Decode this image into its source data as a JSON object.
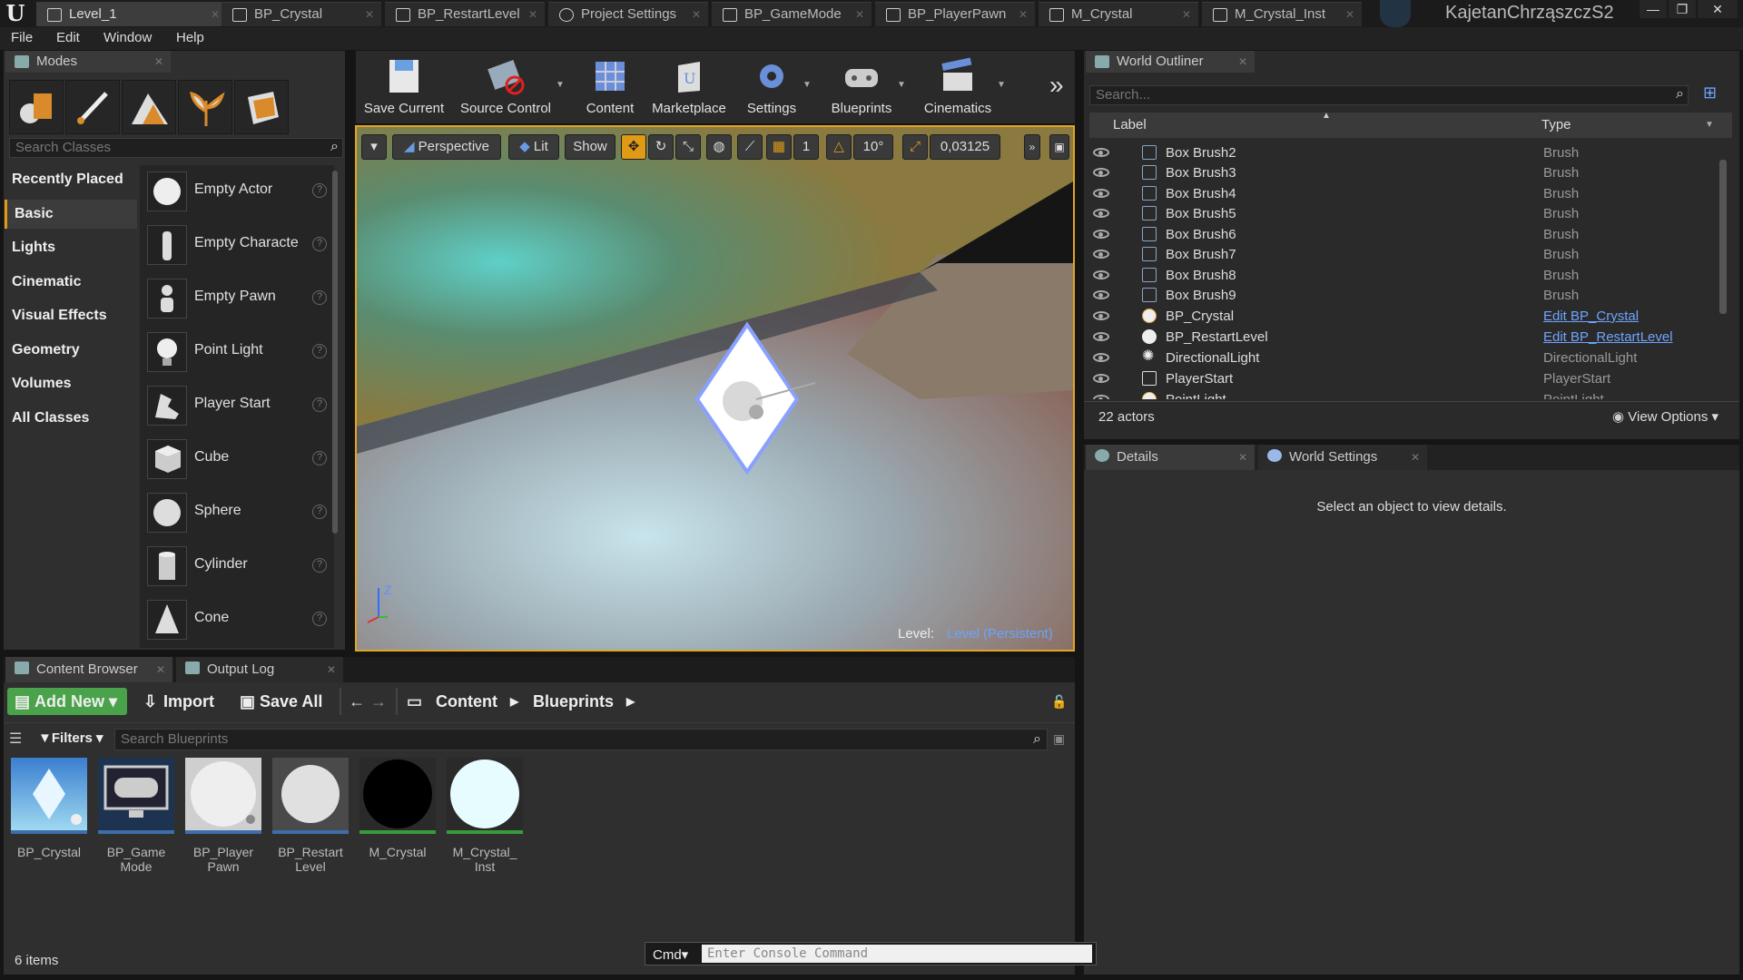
{
  "window": {
    "tabs": [
      {
        "label": "Level_1",
        "active": true
      },
      {
        "label": "BP_Crystal"
      },
      {
        "label": "BP_RestartLevel"
      },
      {
        "label": "Project Settings"
      },
      {
        "label": "BP_GameMode"
      },
      {
        "label": "BP_PlayerPawn"
      },
      {
        "label": "M_Crystal"
      },
      {
        "label": "M_Crystal_Inst"
      }
    ],
    "user": "KajetanChrząszczS2",
    "controls": {
      "minimize": "—",
      "restore": "❐",
      "close": "✕"
    }
  },
  "menu": [
    "File",
    "Edit",
    "Window",
    "Help"
  ],
  "modes": {
    "title": "Modes",
    "search_placeholder": "Search Classes",
    "categories": [
      "Recently Placed",
      "Basic",
      "Lights",
      "Cinematic",
      "Visual Effects",
      "Geometry",
      "Volumes",
      "All Classes"
    ],
    "selected_category": "Basic",
    "items": [
      "Empty Actor",
      "Empty Characte",
      "Empty Pawn",
      "Point Light",
      "Player Start",
      "Cube",
      "Sphere",
      "Cylinder",
      "Cone"
    ]
  },
  "toolbar": {
    "buttons": [
      "Save Current",
      "Source Control",
      "Content",
      "Marketplace",
      "Settings",
      "Blueprints",
      "Cinematics"
    ],
    "more": "»"
  },
  "viewport": {
    "perspective": "Perspective",
    "lit": "Lit",
    "show": "Show",
    "grid_value": "1",
    "angle_value": "10°",
    "scale_value": "0,03125",
    "level_label": "Level:",
    "level_name": "Level (Persistent)",
    "axis_z": "Z"
  },
  "outliner": {
    "title": "World Outliner",
    "search_placeholder": "Search...",
    "col_label": "Label",
    "col_type": "Type",
    "rows": [
      {
        "label": "Box Brush2",
        "type": "Brush"
      },
      {
        "label": "Box Brush3",
        "type": "Brush"
      },
      {
        "label": "Box Brush4",
        "type": "Brush"
      },
      {
        "label": "Box Brush5",
        "type": "Brush"
      },
      {
        "label": "Box Brush6",
        "type": "Brush"
      },
      {
        "label": "Box Brush7",
        "type": "Brush"
      },
      {
        "label": "Box Brush8",
        "type": "Brush"
      },
      {
        "label": "Box Brush9",
        "type": "Brush"
      },
      {
        "label": "BP_Crystal",
        "type": "Edit BP_Crystal"
      },
      {
        "label": "BP_RestartLevel",
        "type": "Edit BP_RestartLevel"
      },
      {
        "label": "DirectionalLight",
        "type": "DirectionalLight"
      },
      {
        "label": "PlayerStart",
        "type": "PlayerStart"
      },
      {
        "label": "PointLight",
        "type": "PointLight"
      }
    ],
    "count": "22 actors",
    "view_options": "View Options"
  },
  "details": {
    "tab1": "Details",
    "tab2": "World Settings",
    "empty_msg": "Select an object to view details."
  },
  "content_browser": {
    "tab1": "Content Browser",
    "tab2": "Output Log",
    "add_new": "Add New",
    "import": "Import",
    "save_all": "Save All",
    "path": [
      "Content",
      "Blueprints"
    ],
    "filters": "Filters",
    "search_placeholder": "Search Blueprints",
    "assets": [
      "BP_Crystal",
      "BP_Game\nMode",
      "BP_Player\nPawn",
      "BP_Restart\nLevel",
      "M_Crystal",
      "M_Crystal_\nInst"
    ],
    "item_count": "6 items"
  },
  "console": {
    "cmd": "Cmd",
    "placeholder": "Enter Console Command"
  },
  "colors": {
    "accent": "#e09a16",
    "link": "#6fa4ff",
    "add_new": "#4aa34a",
    "viewport_border": "#e0a526"
  }
}
